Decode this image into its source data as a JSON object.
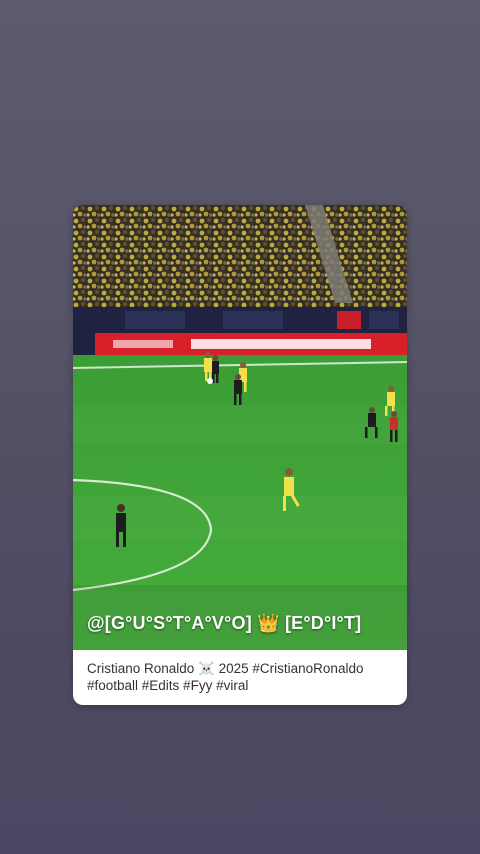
{
  "story": {
    "overlay_text": "@[G°U°S°T°A°V°O] 👑 [E°D°I°T]",
    "caption_line1": "Cristiano Ronaldo ☠️ 2025 #CristianoRonaldo",
    "caption_line2": "#football #Edits #Fyy #viral"
  },
  "colors": {
    "pitch": "#3fa83a",
    "ad_board": "#d8202a",
    "crowd": "#5a5030"
  },
  "media": {
    "scene": "football-match-frame"
  }
}
